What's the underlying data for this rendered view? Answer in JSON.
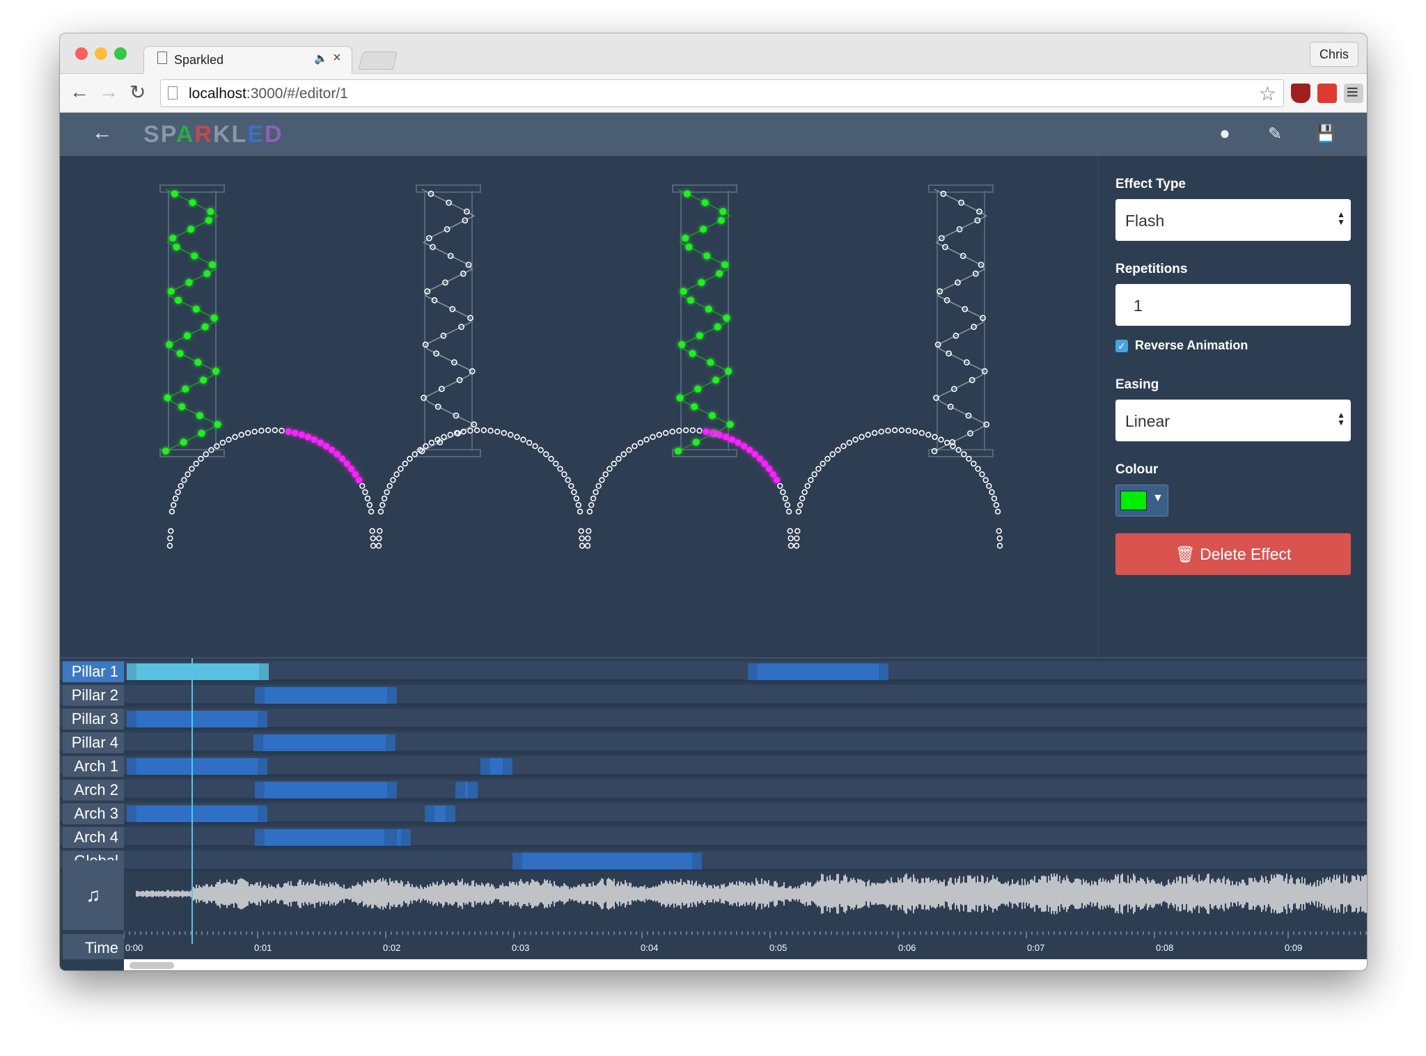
{
  "browser": {
    "tab_title": "Sparkled",
    "url_host": "localhost",
    "url_rest": ":3000/#/editor/1",
    "user": "Chris"
  },
  "app": {
    "logo": "SPARKLED",
    "logo_letter_colors": [
      "#8997a8",
      "#8997a8",
      "#2aa84a",
      "#c24a4a",
      "#8997a8",
      "#8997a8",
      "#3f6fc2",
      "#8a62b8"
    ]
  },
  "panel": {
    "effect_type_label": "Effect Type",
    "effect_type_value": "Flash",
    "repetitions_label": "Repetitions",
    "repetitions_value": "1",
    "reverse_label": "Reverse Animation",
    "reverse_checked": true,
    "easing_label": "Easing",
    "easing_value": "Linear",
    "colour_label": "Colour",
    "colour_value": "#00ee00",
    "delete_label": "Delete Effect"
  },
  "timeline": {
    "rows": [
      {
        "label": "Pillar 1",
        "active": true
      },
      {
        "label": "Pillar 2",
        "active": false
      },
      {
        "label": "Pillar 3",
        "active": false
      },
      {
        "label": "Pillar 4",
        "active": false
      },
      {
        "label": "Arch 1",
        "active": false
      },
      {
        "label": "Arch 2",
        "active": false
      },
      {
        "label": "Arch 3",
        "active": false
      },
      {
        "label": "Arch 4",
        "active": false
      },
      {
        "label": "Global",
        "active": false
      }
    ],
    "time_label": "Time",
    "ticks": [
      "0:00",
      "0:01",
      "0:02",
      "0:03",
      "0:04",
      "0:05",
      "0:06",
      "0:07",
      "0:08",
      "0:09"
    ],
    "cursor_time": "0:00.5"
  },
  "colors": {
    "lit_pillar": "#22ee22",
    "lit_arch": "#ff22ff",
    "unlit": "#ffffff",
    "accent": "#3d79c3",
    "delete": "#d9534f"
  }
}
